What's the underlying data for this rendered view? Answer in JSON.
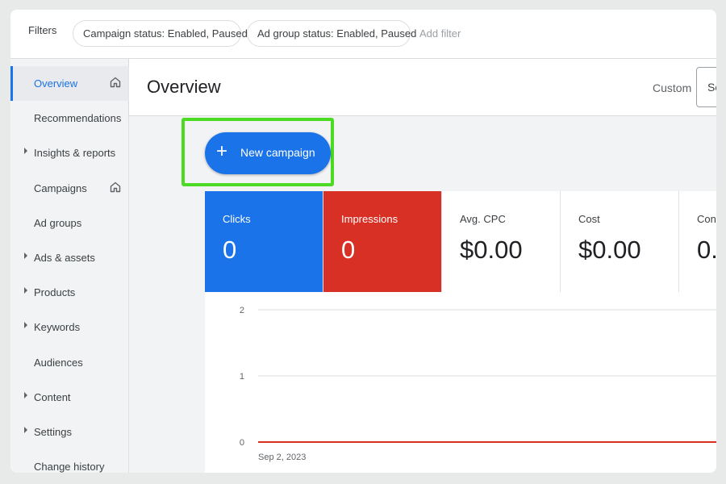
{
  "filters": {
    "label": "Filters",
    "chips": [
      "Campaign status: Enabled, Paused",
      "Ad group status: Enabled, Paused"
    ],
    "add_filter": "Add filter"
  },
  "sidebar": {
    "items": [
      {
        "label": "Overview",
        "caret": false,
        "home": true,
        "active": true
      },
      {
        "label": "Recommendations",
        "caret": false,
        "home": false,
        "active": false
      },
      {
        "label": "Insights & reports",
        "caret": true,
        "home": false,
        "active": false
      },
      {
        "label": "Campaigns",
        "caret": false,
        "home": true,
        "active": false
      },
      {
        "label": "Ad groups",
        "caret": false,
        "home": false,
        "active": false
      },
      {
        "label": "Ads & assets",
        "caret": true,
        "home": false,
        "active": false
      },
      {
        "label": "Products",
        "caret": true,
        "home": false,
        "active": false
      },
      {
        "label": "Keywords",
        "caret": true,
        "home": false,
        "active": false
      },
      {
        "label": "Audiences",
        "caret": false,
        "home": false,
        "active": false
      },
      {
        "label": "Content",
        "caret": true,
        "home": false,
        "active": false
      },
      {
        "label": "Settings",
        "caret": true,
        "home": false,
        "active": false
      },
      {
        "label": "Change history",
        "caret": false,
        "home": false,
        "active": false
      }
    ]
  },
  "header": {
    "title": "Overview",
    "custom_label": "Custom",
    "date_partial": "Se"
  },
  "main": {
    "new_campaign_label": "New campaign",
    "plus_glyph": "+",
    "metrics": [
      {
        "label": "Clicks",
        "value": "0",
        "color": "#1a73e8"
      },
      {
        "label": "Impressions",
        "value": "0",
        "color": "#d93025"
      },
      {
        "label": "Avg. CPC",
        "value": "$0.00",
        "color": "#ffffff"
      },
      {
        "label": "Cost",
        "value": "$0.00",
        "color": "#ffffff"
      },
      {
        "label": "Conv",
        "value": "0.",
        "color": "#ffffff"
      }
    ]
  },
  "chart_data": {
    "type": "line",
    "x": [
      "Sep 2, 2023"
    ],
    "series": [
      {
        "values": [
          0
        ],
        "color": "#d93025"
      }
    ],
    "yticks": [
      "2",
      "1",
      "0"
    ],
    "ylim": [
      0,
      2
    ],
    "grid": true,
    "xlabel": "",
    "ylabel": ""
  },
  "colors": {
    "accent": "#1a73e8",
    "impressions": "#d93025",
    "highlight": "#4cdb23"
  }
}
